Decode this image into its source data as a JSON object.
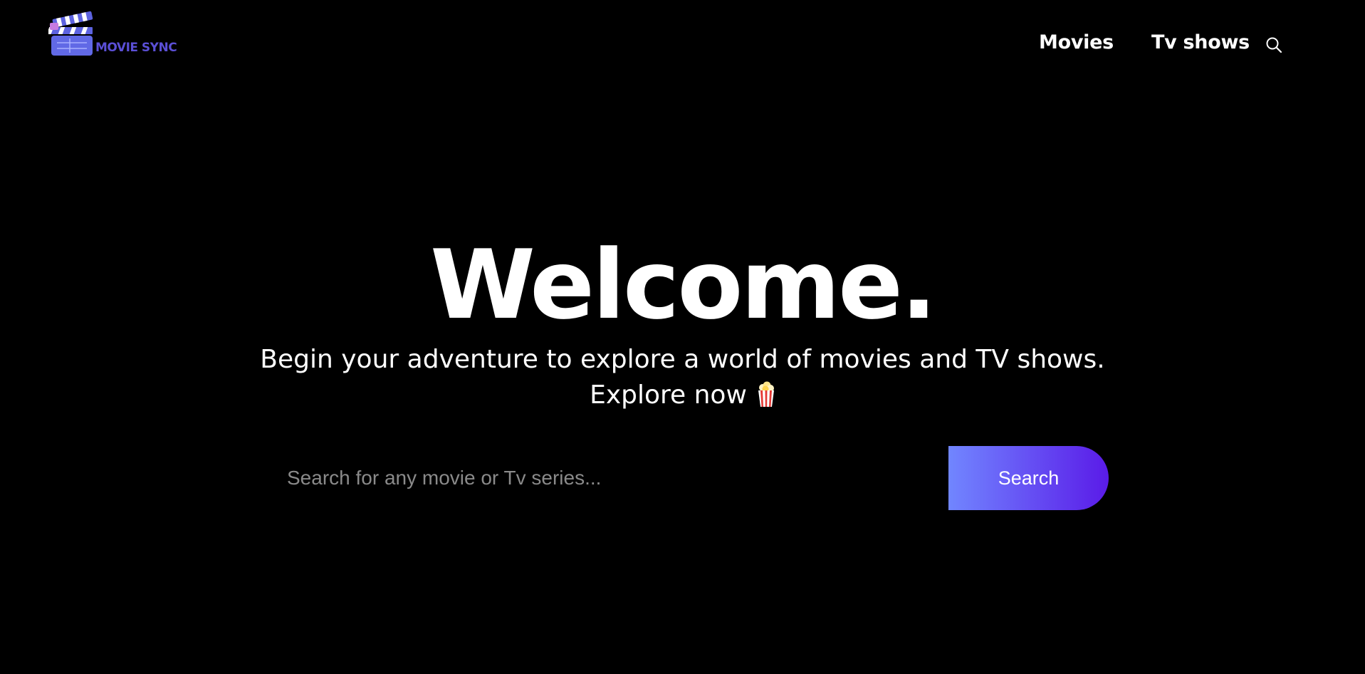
{
  "header": {
    "logo_text": "MOVIE SYNC",
    "nav": {
      "movies_label": "Movies",
      "tv_label": "Tv shows",
      "search_icon": "search-icon"
    }
  },
  "hero": {
    "title": "Welcome.",
    "subtitle_line1": "Begin your adventure to explore a world of movies and TV shows.",
    "subtitle_line2": "Explore now",
    "emoji_icon": "popcorn-icon"
  },
  "search": {
    "placeholder": "Search for any movie or Tv series...",
    "value": "",
    "button_label": "Search"
  },
  "colors": {
    "background": "#000000",
    "text": "#ffffff",
    "button_gradient_start": "#7186ff",
    "button_gradient_end": "#5a1be8",
    "logo": "#5b4fd6"
  }
}
